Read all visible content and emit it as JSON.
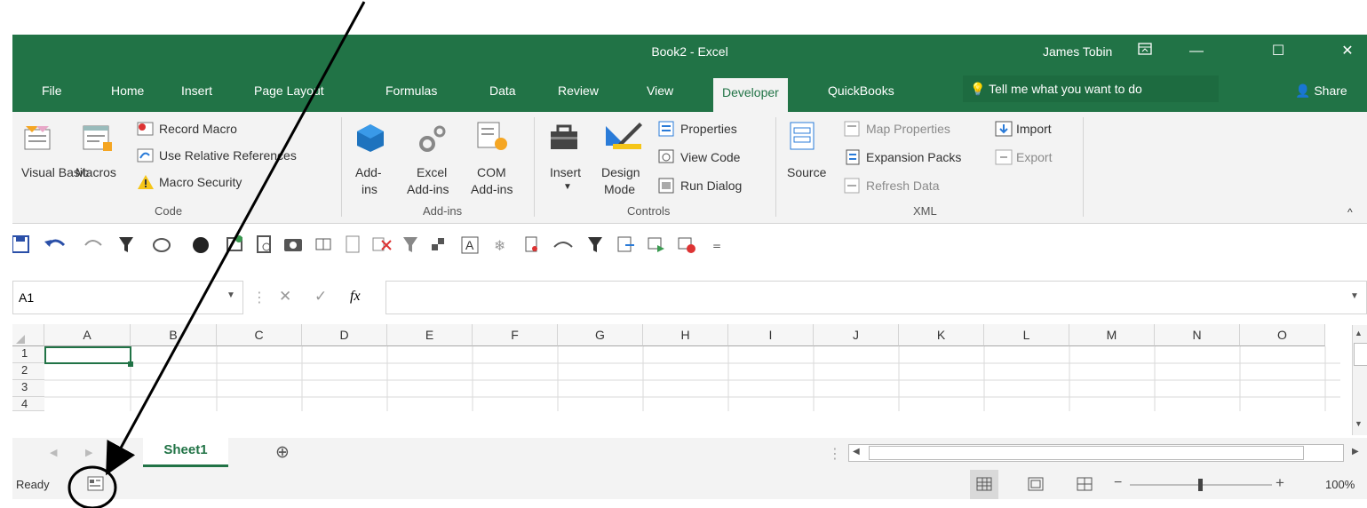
{
  "window": {
    "title": "Book2  -  Excel",
    "user": "James Tobin",
    "controls": [
      "ribbon-display-icon",
      "minimize-icon",
      "maximize-icon",
      "close-icon"
    ]
  },
  "tabs": [
    "File",
    "Home",
    "Insert",
    "Page Layout",
    "Formulas",
    "Data",
    "Review",
    "View",
    "Developer",
    "QuickBooks"
  ],
  "active_tab": "Developer",
  "tell_me": "Tell me what you want to do",
  "share": "Share",
  "ribbon": {
    "code": {
      "group": "Code",
      "visual_basic": "Visual Basic",
      "macros": "Macros",
      "record_macro": "Record Macro",
      "use_relative": "Use Relative References",
      "macro_security": "Macro Security"
    },
    "addins": {
      "group": "Add-ins",
      "addins": [
        "Add-",
        "ins"
      ],
      "excel_addins": [
        "Excel",
        "Add-ins"
      ],
      "com_addins": [
        "COM",
        "Add-ins"
      ]
    },
    "controls": {
      "group": "Controls",
      "insert": "Insert",
      "design_mode": [
        "Design",
        "Mode"
      ],
      "properties": "Properties",
      "view_code": "View Code",
      "run_dialog": "Run Dialog"
    },
    "xml": {
      "group": "XML",
      "source": "Source",
      "map_properties": "Map Properties",
      "expansion_packs": "Expansion Packs",
      "refresh_data": "Refresh Data",
      "import": "Import",
      "export": "Export"
    }
  },
  "name_box": "A1",
  "fx": "fx",
  "columns": [
    "A",
    "B",
    "C",
    "D",
    "E",
    "F",
    "G",
    "H",
    "I",
    "J",
    "K",
    "L",
    "M",
    "N",
    "O"
  ],
  "rows": [
    "1",
    "2",
    "3",
    "4"
  ],
  "sheet_tab": "Sheet1",
  "status": {
    "ready": "Ready",
    "zoom": "100%",
    "zoom_fraction": 0.5
  },
  "colors": {
    "excel_green": "#217346",
    "ribbon_bg": "#f3f3f3"
  }
}
